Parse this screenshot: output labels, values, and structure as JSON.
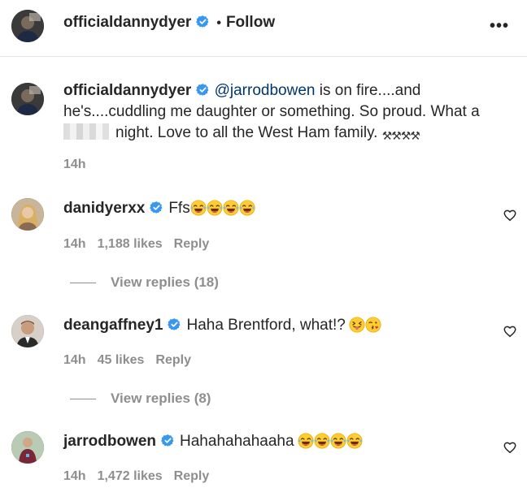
{
  "header": {
    "username": "officialdannydyer",
    "separator": "•",
    "follow_label": "Follow",
    "more_label": "•••"
  },
  "caption": {
    "username": "officialdannydyer",
    "mention": "@jarrodbowen",
    "text_part1": " is on fire....and he's....cuddling me daughter or something. So proud. What a ",
    "text_part2": "night. Love to all the West Ham family. ",
    "trailing_emoji": "⚒⚒⚒⚒",
    "time": "14h"
  },
  "comments": [
    {
      "username": "danidyerxx",
      "text": "Ffs",
      "emojis": [
        "face-with-tears-of-joy",
        "face-with-tears-of-joy",
        "face-with-tears-of-joy",
        "face-with-tears-of-joy"
      ],
      "time": "14h",
      "likes": "1,188 likes",
      "reply_label": "Reply",
      "view_replies": "View replies (18)"
    },
    {
      "username": "deangaffney1",
      "text": "Haha Brentford, what!?",
      "emojis": [
        "squinting-face-with-tongue",
        "face-blowing-a-kiss"
      ],
      "time": "14h",
      "likes": "45 likes",
      "reply_label": "Reply",
      "view_replies": "View replies (8)"
    },
    {
      "username": "jarrodbowen",
      "text": "Hahahahahaaha",
      "emojis": [
        "face-with-tears-of-joy",
        "face-with-tears-of-joy",
        "face-with-tears-of-joy",
        "face-with-tears-of-joy"
      ],
      "time": "14h",
      "likes": "1,472 likes",
      "reply_label": "Reply"
    }
  ],
  "icons": {
    "verified": "verified-badge-icon",
    "like": "heart-outline-icon"
  },
  "colors": {
    "text": "#262626",
    "secondary": "#8e8e8e",
    "mention": "#00376b",
    "verified": "#3897f0"
  }
}
